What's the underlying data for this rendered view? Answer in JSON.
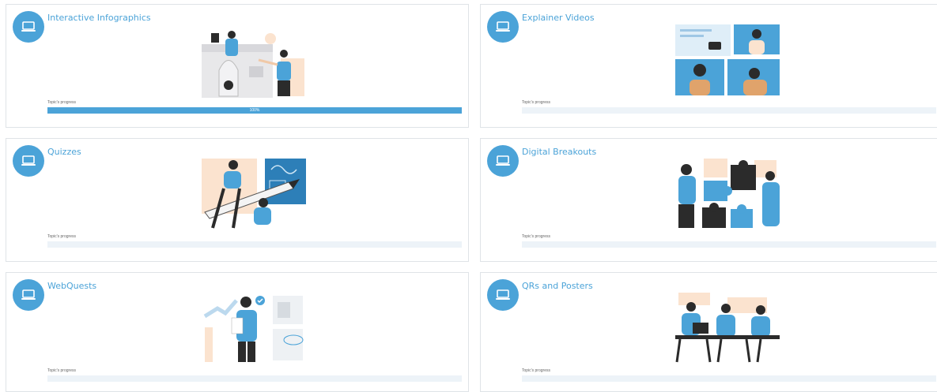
{
  "accent": "#4ba3d8",
  "topics": [
    {
      "title": "Interactive Infographics",
      "progress_label": "Topic's progress",
      "progress": 100,
      "progress_text": "100%",
      "icon": "laptop-icon",
      "illustration": "infographics-illustration"
    },
    {
      "title": "Explainer Videos",
      "progress_label": "Topic's progress",
      "progress": 0,
      "progress_text": "",
      "icon": "laptop-icon",
      "illustration": "video-call-illustration"
    },
    {
      "title": "Quizzes",
      "progress_label": "Topic's progress",
      "progress": 0,
      "progress_text": "",
      "icon": "laptop-icon",
      "illustration": "giant-pencil-illustration"
    },
    {
      "title": "Digital Breakouts",
      "progress_label": "Topic's progress",
      "progress": 0,
      "progress_text": "",
      "icon": "laptop-icon",
      "illustration": "puzzle-pieces-illustration"
    },
    {
      "title": "WebQuests",
      "progress_label": "Topic's progress",
      "progress": 0,
      "progress_text": "",
      "icon": "laptop-icon",
      "illustration": "charts-checklist-illustration"
    },
    {
      "title": "QRs and Posters",
      "progress_label": "Topic's progress",
      "progress": 0,
      "progress_text": "",
      "icon": "laptop-icon",
      "illustration": "team-meeting-illustration"
    }
  ]
}
